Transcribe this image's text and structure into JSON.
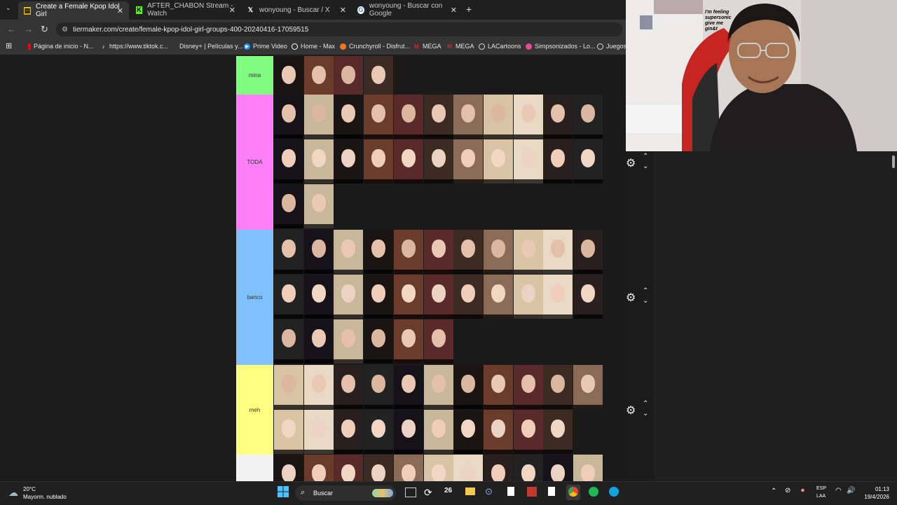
{
  "browser": {
    "tabs": [
      {
        "label": "Create a Female Kpop Idol Girl",
        "icon": "tiermaker-icon",
        "active": true
      },
      {
        "label": "AFTER_CHABON Stream - Watch",
        "icon": "kick-icon",
        "active": false
      },
      {
        "label": "wonyoung - Buscar / X",
        "icon": "x-icon",
        "active": false
      },
      {
        "label": "wonyoung - Buscar con Google",
        "icon": "google-icon",
        "active": false
      }
    ],
    "url": "tiermaker.com/create/female-kpop-idol-girl-groups-400-20240416-17059515",
    "bookmarks": [
      {
        "label": "Página de inicio - N...",
        "icon": "netflix-icon"
      },
      {
        "label": "https://www.tiktok.c...",
        "icon": "tiktok-icon"
      },
      {
        "label": "Disney+ | Películas y...",
        "icon": "disney-icon"
      },
      {
        "label": "Prime Video",
        "icon": "prime-icon"
      },
      {
        "label": "Home - Max",
        "icon": "max-icon"
      },
      {
        "label": "Crunchyroll - Disfrut...",
        "icon": "crunchyroll-icon"
      },
      {
        "label": "MEGA",
        "icon": "mega-icon"
      },
      {
        "label": "MEGA",
        "icon": "mega-icon"
      },
      {
        "label": "LACartoons",
        "icon": "lacartoons-icon"
      },
      {
        "label": "Simpsonizados - Lo...",
        "icon": "simpsons-icon"
      },
      {
        "label": "Juegos",
        "icon": "games-icon"
      }
    ]
  },
  "tiers": [
    {
      "label": "mina",
      "color": "#7ffc7f"
    },
    {
      "label": "TODA",
      "color": "#ff7ff8"
    },
    {
      "label": "banco",
      "color": "#7fc0ff"
    },
    {
      "label": "meh",
      "color": "#ffff7f"
    },
    {
      "label": "",
      "color": "#f2f2f2"
    }
  ],
  "webcam": {
    "sticker_text": "I'm feeling supersonic give me gin&t"
  },
  "taskbar": {
    "weather_temp": "20°C",
    "weather_desc": "Mayorm. nublado",
    "search_placeholder": "Buscar",
    "calendar_badge": "26",
    "lang": "ESP",
    "lang_region": "LAA",
    "time": "01:13",
    "date": "19/4/2026"
  }
}
